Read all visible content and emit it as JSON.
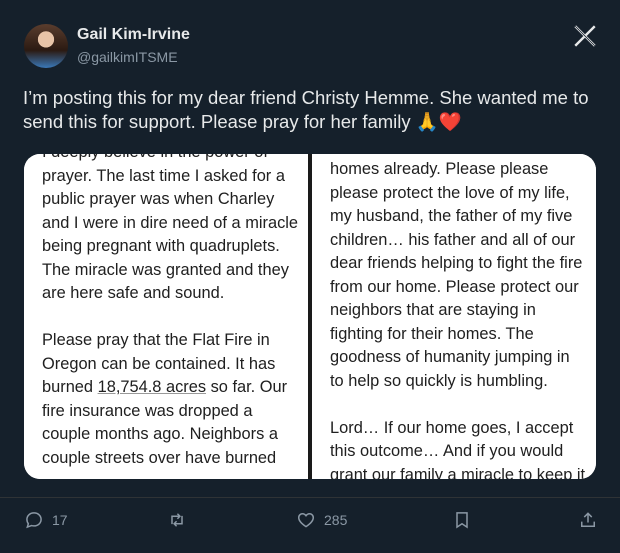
{
  "author": {
    "name": "Gail Kim-Irvine",
    "handle": "@gailkimITSME"
  },
  "tweet": {
    "text": "I’m posting this for my dear friend Christy Hemme. She wanted me to send this for support. Please pray for her family",
    "emoji": "🙏❤️"
  },
  "media": {
    "left_page_lines": [
      "I deeply believe in the power of",
      "prayer. The last time I asked for a",
      "public prayer was when Charley",
      "and I were in dire need of a miracle",
      "being pregnant with quadruplets.",
      "The miracle was granted and they",
      "are here safe and sound.",
      "",
      "Please pray that the Flat Fire in",
      "Oregon can be contained. It has",
      "burned 18,754.8 acres so far. Our",
      "fire insurance was dropped a",
      "couple months ago. Neighbors a",
      "couple streets over have burned"
    ],
    "right_page_lines": [
      "homes already. Please please",
      "please protect the love of my life,",
      "my husband, the father of my five",
      "children… his father and all of our",
      "dear friends helping to fight the fire",
      "from our home. Please protect our",
      "neighbors that are staying in",
      "fighting for their homes. The",
      "goodness of humanity jumping in",
      "to help so quickly is humbling.",
      "",
      "Lord… If our home goes, I accept",
      "this outcome… And if you would",
      "grant our family a miracle to keep it"
    ]
  },
  "actions": {
    "replies": "17",
    "likes": "285"
  },
  "colors": {
    "background": "#15202b",
    "secondary_text": "#8b98a5"
  }
}
